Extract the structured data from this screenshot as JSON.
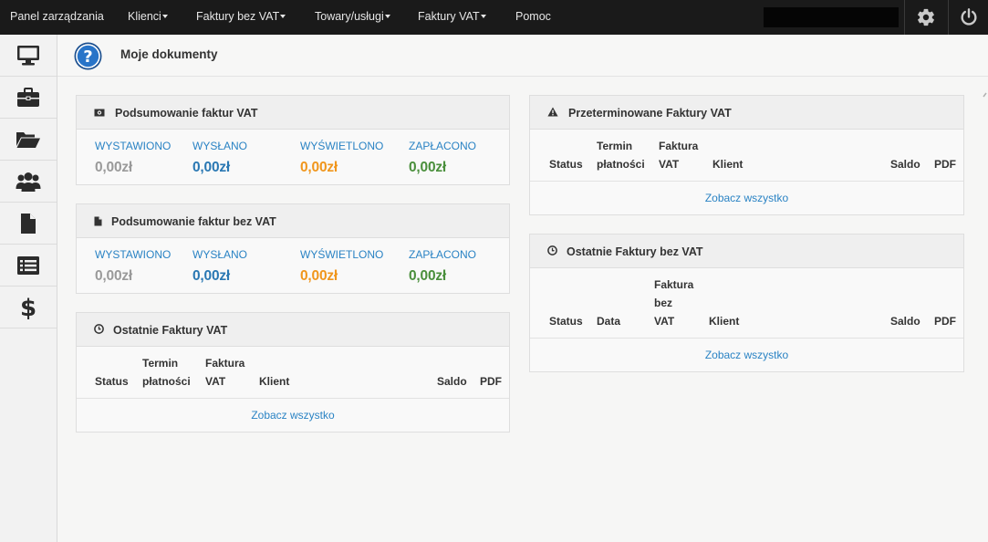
{
  "topnav": {
    "items": [
      {
        "label": "Panel zarządzania",
        "dropdown": false
      },
      {
        "label": "Klienci",
        "dropdown": true
      },
      {
        "label": "Faktury bez VAT",
        "dropdown": true
      },
      {
        "label": "Towary/usługi",
        "dropdown": true
      },
      {
        "label": "Faktury VAT",
        "dropdown": true
      },
      {
        "label": "Pomoc",
        "dropdown": false
      }
    ],
    "search_placeholder": "",
    "icons": [
      "gear-icon",
      "power-icon"
    ]
  },
  "sidebar": {
    "items": [
      {
        "icon": "monitor-icon"
      },
      {
        "icon": "briefcase-icon"
      },
      {
        "icon": "folder-open-icon"
      },
      {
        "icon": "users-icon"
      },
      {
        "icon": "file-icon"
      },
      {
        "icon": "list-icon"
      },
      {
        "icon": "dollar-icon"
      }
    ]
  },
  "header": {
    "title": "Moje dokumenty",
    "icon": "help-icon"
  },
  "colors": {
    "label_blue": "#2a83c4",
    "issued_gray": "#9a9a9a",
    "sent_blue": "#2a78b3",
    "viewed_orange": "#f0961c",
    "paid_green": "#4a8f3c"
  },
  "summary_vat": {
    "title": "Podsumowanie faktur VAT",
    "icon": "money-icon",
    "stats": [
      {
        "label": "WYSTAWIONO",
        "value": "0,00zł"
      },
      {
        "label": "WYSŁANO",
        "value": "0,00zł"
      },
      {
        "label": "WYŚWIETLONO",
        "value": "0,00zł"
      },
      {
        "label": "ZAPŁACONO",
        "value": "0,00zł"
      }
    ]
  },
  "summary_novat": {
    "title": "Podsumowanie faktur bez VAT",
    "icon": "file-small-icon",
    "stats": [
      {
        "label": "WYSTAWIONO",
        "value": "0,00zł"
      },
      {
        "label": "WYSŁANO",
        "value": "0,00zł"
      },
      {
        "label": "WYŚWIETLONO",
        "value": "0,00zł"
      },
      {
        "label": "ZAPŁACONO",
        "value": "0,00zł"
      }
    ]
  },
  "recent_vat": {
    "title": "Ostatnie Faktury VAT",
    "icon": "clock-icon",
    "columns": [
      "Status",
      "Termin płatności",
      "Faktura VAT",
      "Klient",
      "Saldo",
      "PDF"
    ],
    "see_all": "Zobacz wszystko"
  },
  "overdue_vat": {
    "title": "Przeterminowane Faktury VAT",
    "icon": "warning-icon",
    "columns": [
      "Status",
      "Termin płatności",
      "Faktura VAT",
      "Klient",
      "Saldo",
      "PDF"
    ],
    "see_all": "Zobacz wszystko"
  },
  "recent_novat": {
    "title": "Ostatnie Faktury bez VAT",
    "icon": "clock-icon",
    "columns": [
      "Status",
      "Data",
      "Faktura bez VAT",
      "Klient",
      "Saldo",
      "PDF"
    ],
    "see_all": "Zobacz wszystko"
  }
}
